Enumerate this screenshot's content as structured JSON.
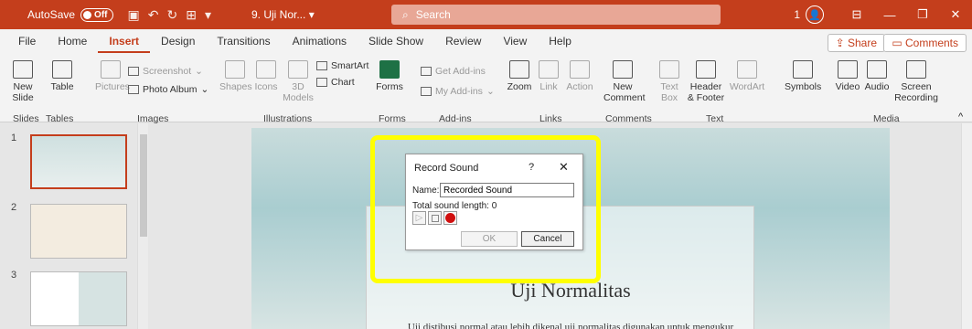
{
  "titlebar": {
    "autosave": "AutoSave",
    "autosave_state": "Off",
    "doc_title": "9. Uji Nor...",
    "search_placeholder": "Search",
    "badge": "1"
  },
  "tabs": [
    "File",
    "Home",
    "Insert",
    "Design",
    "Transitions",
    "Animations",
    "Slide Show",
    "Review",
    "View",
    "Help"
  ],
  "share_label": "Share",
  "comments_label": "Comments",
  "ribbon": {
    "new_slide": "New Slide",
    "table": "Table",
    "pictures": "Pictures",
    "screenshot": "Screenshot",
    "photo_album": "Photo Album",
    "shapes": "Shapes",
    "icons": "Icons",
    "models": "3D Models",
    "smartart": "SmartArt",
    "chart": "Chart",
    "forms": "Forms",
    "get_addins": "Get Add-ins",
    "my_addins": "My Add-ins",
    "zoom": "Zoom",
    "link": "Link",
    "action": "Action",
    "new_comment": "New Comment",
    "textbox": "Text Box",
    "header_footer": "Header & Footer",
    "wordart": "WordArt",
    "symbols": "Symbols",
    "video": "Video",
    "audio": "Audio",
    "screen_recording": "Screen Recording"
  },
  "groups": [
    "Slides",
    "Tables",
    "Images",
    "Illustrations",
    "Forms",
    "Add-ins",
    "Links",
    "Comments",
    "Text",
    "Media"
  ],
  "slides": [
    "1",
    "2",
    "3"
  ],
  "slide": {
    "title": "Uji Normalitas",
    "text": "Uji distibusi normal atau lebih dikenal uji normalitas digunakan untuk mengukur"
  },
  "dialog": {
    "title": "Record Sound",
    "help": "?",
    "close": "✕",
    "name_label": "Name:",
    "name_value": "Recorded Sound",
    "length_label": "Total sound length:",
    "length_value": "0",
    "ok": "OK",
    "cancel": "Cancel"
  }
}
